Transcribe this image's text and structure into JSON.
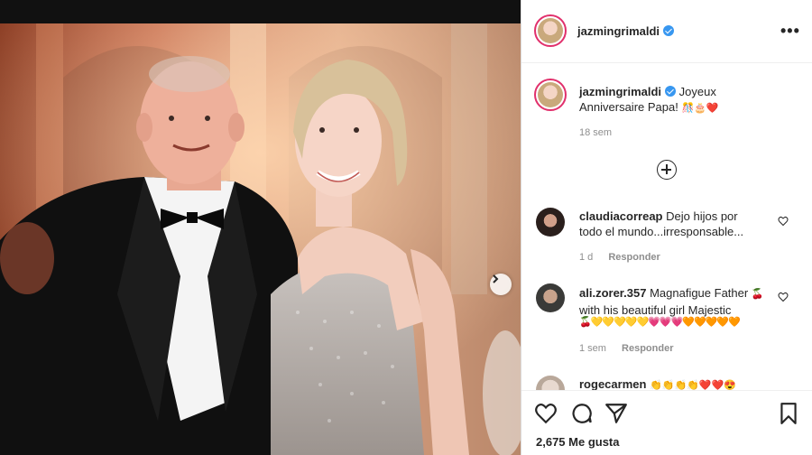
{
  "post": {
    "author": "jazmingrimaldi",
    "more_label": "•••"
  },
  "caption": {
    "username": "jazmingrimaldi",
    "line1": "Joyeux",
    "line2": "Anniversaire Papa!",
    "emojis": "🎊🎂❤️",
    "time": "18 sem"
  },
  "comments": [
    {
      "username": "claudiacorreap",
      "text1": "Dejo hijos por",
      "text2": "todo el mundo...irresponsable...",
      "time": "1 d",
      "reply": "Responder"
    },
    {
      "username": "ali.zorer.357",
      "text1": "Magnafigue Father",
      "text2": "with his beautiful girl Majestic",
      "emojis": "🍒💛💛💛💛💛💗💗💗🧡🧡🧡🧡🧡",
      "emoji_tail": "🍒",
      "time": "1 sem",
      "reply": "Responder"
    },
    {
      "username": "rogecarmen",
      "emojis": "👏👏👏👏❤️❤️😍"
    }
  ],
  "likes": "2,675 Me gusta",
  "colors": {
    "verified": "#3897f0",
    "ring": "#e1306c"
  },
  "icons": [
    "heart-icon",
    "comment-icon",
    "share-icon",
    "bookmark-icon",
    "next-arrow-icon",
    "add-comment-icon",
    "more-icon"
  ]
}
